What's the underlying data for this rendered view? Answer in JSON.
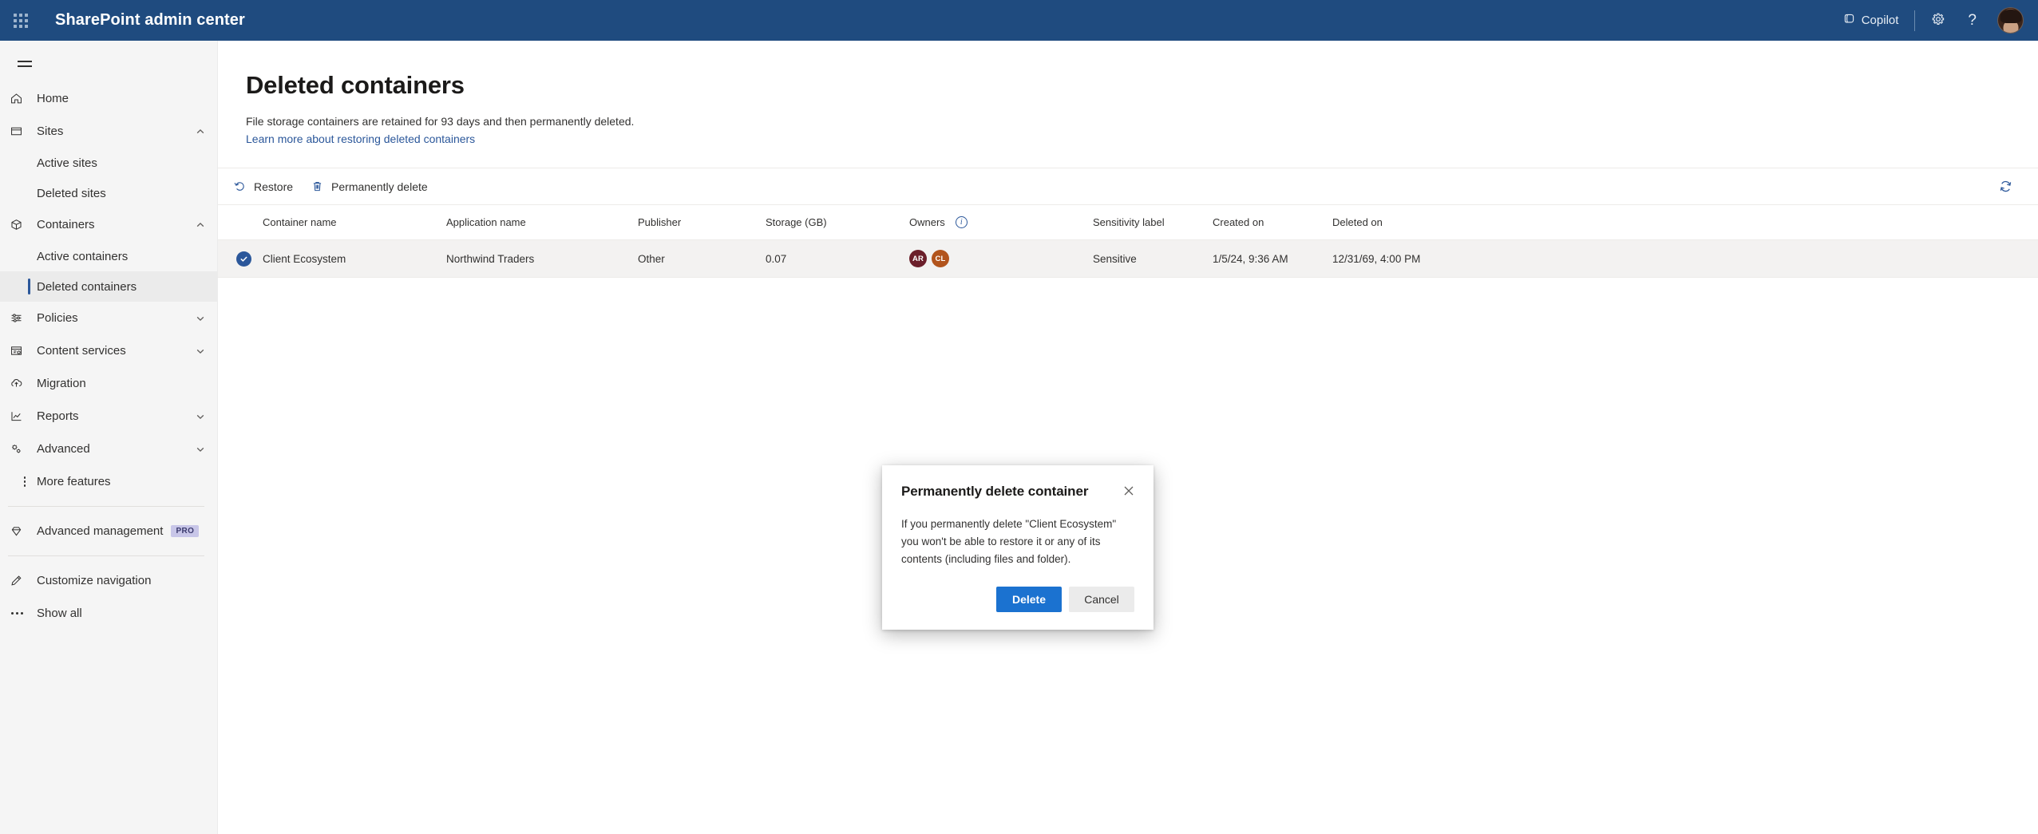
{
  "suite": {
    "waffle_label": "app-launcher",
    "title": "SharePoint admin center",
    "copilot_label": "Copilot",
    "settings_label": "Settings",
    "help_label": "?",
    "account_label": "Account manager"
  },
  "sidebar": {
    "menu_label": "Global navigation",
    "items": [
      {
        "label": "Home",
        "icon": "home-icon",
        "type": "item"
      },
      {
        "label": "Sites",
        "icon": "sites-icon",
        "type": "group",
        "expanded": true
      },
      {
        "label": "Active sites",
        "type": "sub",
        "selected": false
      },
      {
        "label": "Deleted sites",
        "type": "sub",
        "selected": false
      },
      {
        "label": "Containers",
        "icon": "containers-icon",
        "type": "group",
        "expanded": true
      },
      {
        "label": "Active containers",
        "type": "sub",
        "selected": false
      },
      {
        "label": "Deleted containers",
        "type": "sub",
        "selected": true
      },
      {
        "label": "Policies",
        "icon": "policies-icon",
        "type": "group",
        "expanded": false
      },
      {
        "label": "Content services",
        "icon": "content-services-icon",
        "type": "group",
        "expanded": false
      },
      {
        "label": "Migration",
        "icon": "migration-icon",
        "type": "item"
      },
      {
        "label": "Reports",
        "icon": "reports-icon",
        "type": "group",
        "expanded": false
      },
      {
        "label": "Advanced",
        "icon": "advanced-icon",
        "type": "group",
        "expanded": false
      },
      {
        "label": "More features",
        "icon": "more-features-icon",
        "type": "item"
      }
    ],
    "advanced_management": {
      "label": "Advanced management",
      "badge": "PRO"
    },
    "customize_navigation": "Customize navigation",
    "show_all": "Show all"
  },
  "page": {
    "title": "Deleted containers",
    "description": "File storage containers are retained for 93 days and then permanently deleted.",
    "link": "Learn more about restoring deleted containers"
  },
  "commandbar": {
    "restore_label": "Restore",
    "permanently_delete_label": "Permanently delete",
    "refresh_label": "Refresh"
  },
  "table": {
    "columns": [
      "Container name",
      "Application name",
      "Publisher",
      "Storage (GB)",
      "Owners",
      "Sensitivity label",
      "Created on",
      "Deleted on"
    ],
    "owners_info_tooltip": "i",
    "rows": [
      {
        "selected": true,
        "container_name": "Client Ecosystem",
        "application_name": "Northwind Traders",
        "publisher": "Other",
        "storage_gb": "0.07",
        "owners": [
          {
            "initials": "AR",
            "color": "#6b1f2a"
          },
          {
            "initials": "CL",
            "color": "#b2541c"
          }
        ],
        "sensitivity_label": "Sensitive",
        "created_on": "1/5/24, 9:36 AM",
        "deleted_on": "12/31/69, 4:00 PM"
      }
    ]
  },
  "dialog": {
    "title": "Permanently delete container",
    "close_label": "Close",
    "body": "If you permanently delete \"Client Ecosystem\" you won't be able to restore it or any of its contents (including files and folder).",
    "confirm_label": "Delete",
    "cancel_label": "Cancel"
  },
  "colors": {
    "suite_bar": "#1f4b7f",
    "accent": "#2b579a",
    "primary_button": "#1b72d0",
    "selected_row": "#f3f2f1",
    "sidebar_bg": "#f5f5f5"
  }
}
